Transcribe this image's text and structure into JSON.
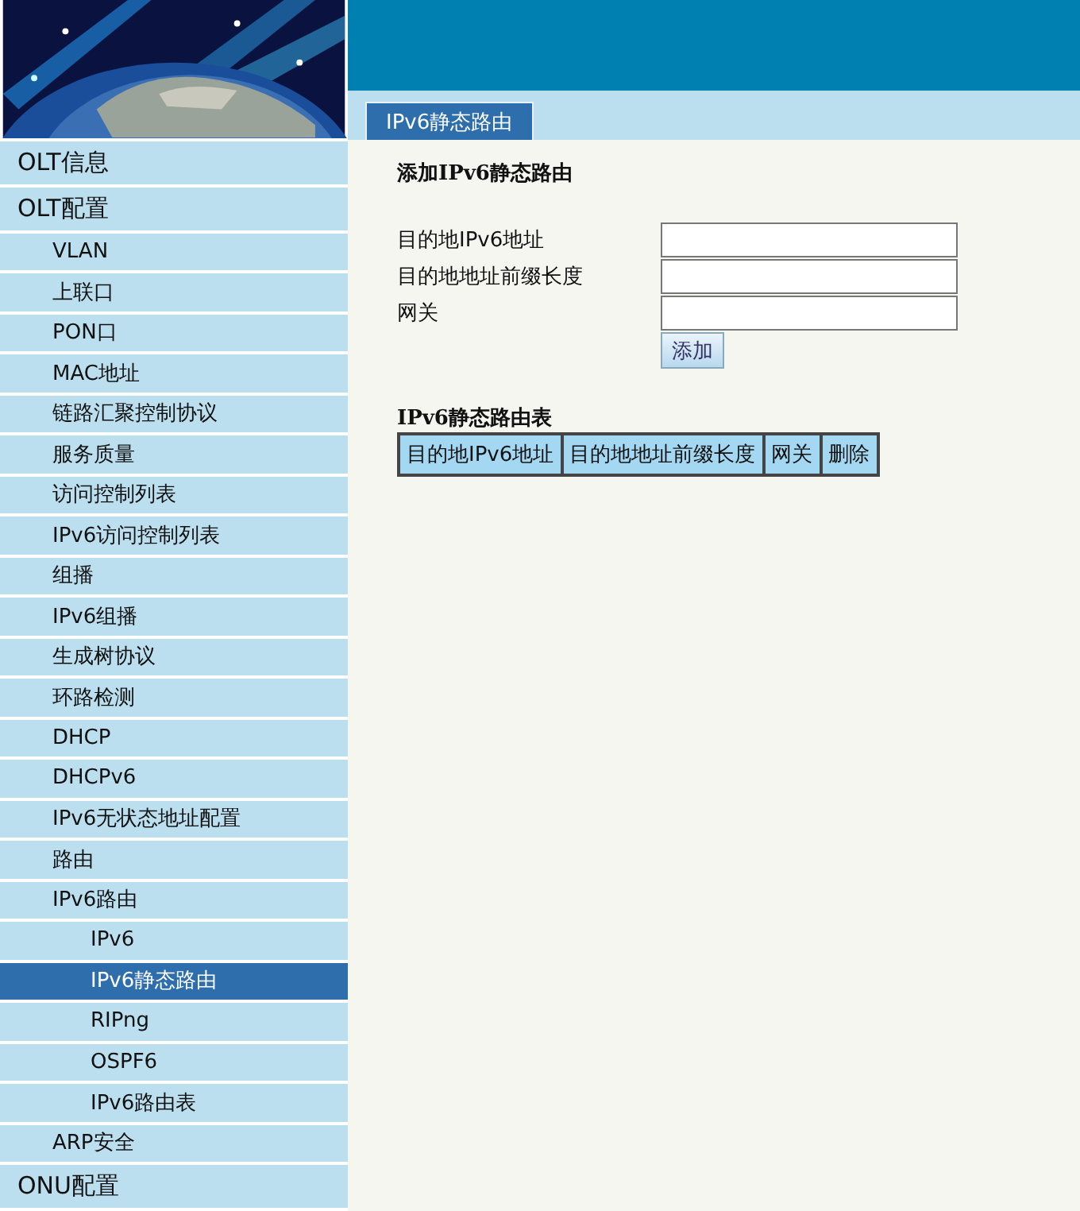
{
  "sidebar": {
    "items": [
      {
        "label": "OLT信息",
        "selected": false
      },
      {
        "label": "OLT配置",
        "selected": false,
        "children": [
          {
            "label": "VLAN",
            "selected": false
          },
          {
            "label": "上联口",
            "selected": false
          },
          {
            "label": "PON口",
            "selected": false
          },
          {
            "label": "MAC地址",
            "selected": false
          },
          {
            "label": "链路汇聚控制协议",
            "selected": false
          },
          {
            "label": "服务质量",
            "selected": false
          },
          {
            "label": "访问控制列表",
            "selected": false
          },
          {
            "label": "IPv6访问控制列表",
            "selected": false
          },
          {
            "label": "组播",
            "selected": false
          },
          {
            "label": "IPv6组播",
            "selected": false
          },
          {
            "label": "生成树协议",
            "selected": false
          },
          {
            "label": "环路检测",
            "selected": false
          },
          {
            "label": "DHCP",
            "selected": false
          },
          {
            "label": "DHCPv6",
            "selected": false
          },
          {
            "label": "IPv6无状态地址配置",
            "selected": false
          },
          {
            "label": "路由",
            "selected": false
          },
          {
            "label": "IPv6路由",
            "selected": false,
            "children": [
              {
                "label": "IPv6",
                "selected": false
              },
              {
                "label": "IPv6静态路由",
                "selected": true
              },
              {
                "label": "RIPng",
                "selected": false
              },
              {
                "label": "OSPF6",
                "selected": false
              },
              {
                "label": "IPv6路由表",
                "selected": false
              }
            ]
          },
          {
            "label": "ARP安全",
            "selected": false
          }
        ]
      },
      {
        "label": "ONU配置",
        "selected": false
      }
    ]
  },
  "tabs": [
    {
      "label": "IPv6静态路由",
      "selected": true
    }
  ],
  "form": {
    "title": "添加IPv6静态路由",
    "fields": [
      {
        "label": "目的地IPv6地址"
      },
      {
        "label": "目的地地址前缀长度"
      },
      {
        "label": "网关"
      }
    ],
    "button": "添加"
  },
  "table": {
    "title": "IPv6静态路由表",
    "columns": [
      "目的地IPv6地址",
      "目的地地址前缀长度",
      "网关",
      "删除"
    ]
  }
}
